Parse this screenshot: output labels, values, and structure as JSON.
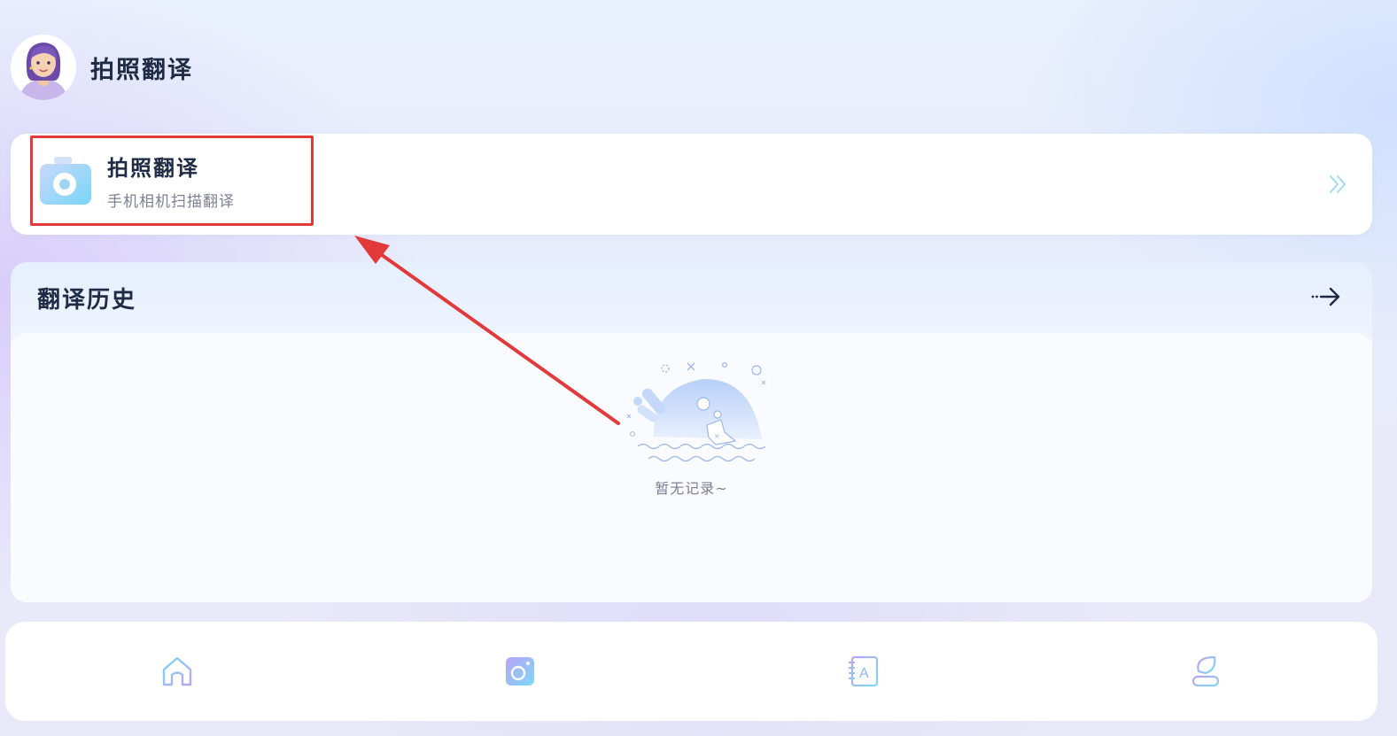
{
  "header": {
    "title": "拍照翻译",
    "avatar_icon": "avatar-girl-icon"
  },
  "photo_card": {
    "title": "拍照翻译",
    "subtitle": "手机相机扫描翻译",
    "icon": "camera-icon",
    "chevron_icon": "double-chevron-right-icon"
  },
  "history": {
    "title": "翻译历史",
    "more_icon": "arrow-right-icon",
    "empty_text": "暂无记录~",
    "empty_icon": "empty-state-illustration"
  },
  "bottom_nav": {
    "items": [
      {
        "icon": "home-icon"
      },
      {
        "icon": "camera-icon"
      },
      {
        "icon": "dictionary-icon"
      },
      {
        "icon": "profile-icon"
      }
    ]
  },
  "colors": {
    "highlight_box": "#e23a3a",
    "title_text": "#1f2a44",
    "muted_text": "#7b8191",
    "accent_cyan": "#7dd8f6",
    "accent_purple": "#b9a3f5"
  }
}
